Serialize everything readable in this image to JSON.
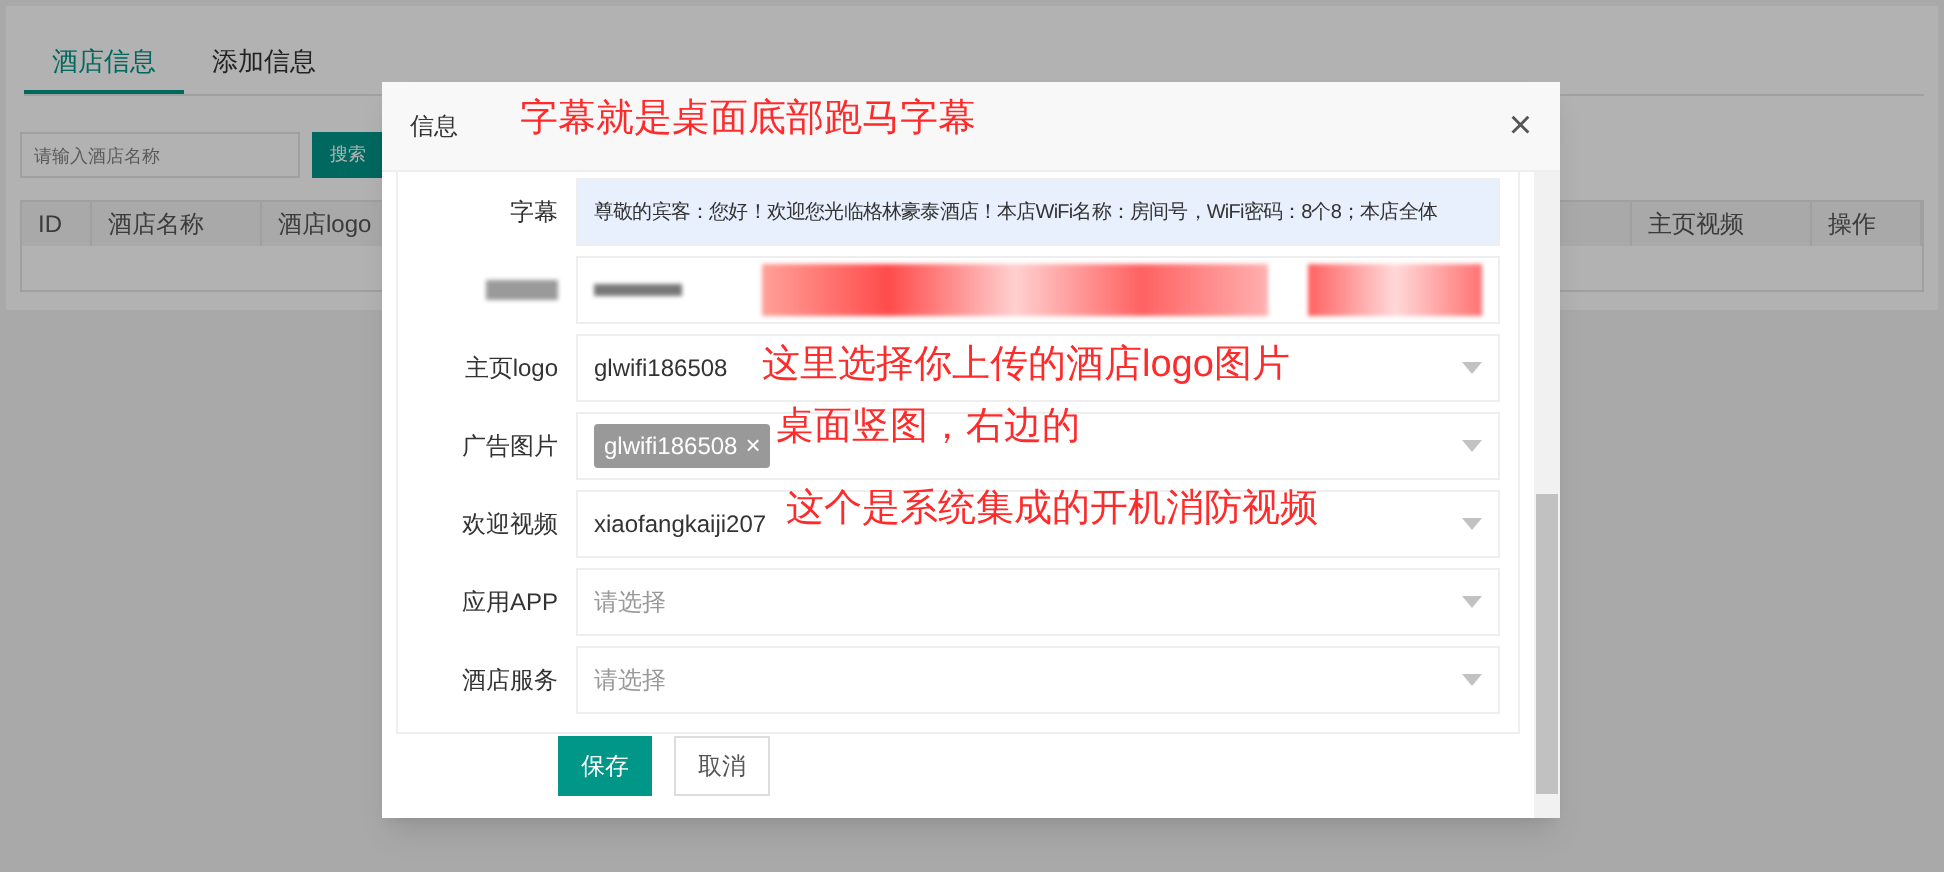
{
  "page": {
    "tabs": [
      {
        "label": "酒店信息",
        "selected": true
      },
      {
        "label": "添加信息",
        "selected": false
      }
    ],
    "search": {
      "placeholder": "请输入酒店名称",
      "button": "搜索"
    },
    "table": {
      "columns": [
        "ID",
        "酒店名称",
        "酒店logo",
        "主页视频",
        "操作"
      ]
    }
  },
  "dialog": {
    "title": "信息",
    "close": "×",
    "fields": [
      {
        "kind": "text",
        "label": "字幕",
        "value": "尊敬的宾客：您好！欢迎您光临格林豪泰酒店！本店WiFi名称：房间号，WiFi密码：8个8；本店全体"
      },
      {
        "kind": "redacted"
      },
      {
        "kind": "select",
        "label": "主页logo",
        "value": "glwifi186508"
      },
      {
        "kind": "tags",
        "label": "广告图片",
        "tags": [
          "glwifi186508"
        ],
        "tag_remove": "×"
      },
      {
        "kind": "select",
        "label": "欢迎视频",
        "value": "xiaofangkaiji207"
      },
      {
        "kind": "select",
        "label": "应用APP",
        "placeholder": "请选择"
      },
      {
        "kind": "select",
        "label": "酒店服务",
        "placeholder": "请选择"
      }
    ],
    "buttons": [
      {
        "label": "保存",
        "kind": "primary"
      },
      {
        "label": "取消",
        "kind": "secondary"
      }
    ]
  },
  "annotations": [
    "字幕就是桌面底部跑马字幕",
    "这里选择你上传的酒店logo图片",
    "桌面竖图，右边的",
    "这个是系统集成的开机消防视频"
  ]
}
